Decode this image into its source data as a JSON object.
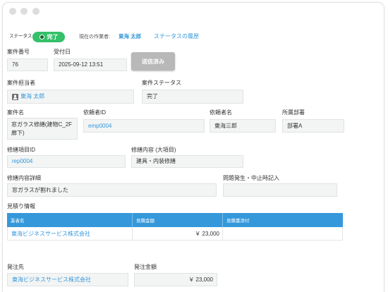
{
  "colors": {
    "link": "#3498db",
    "accent": "#3498db",
    "badge": "#35c06a",
    "field_bg": "#f3f4f4",
    "field_border": "#e0e3e4",
    "button": "#b8b8b8",
    "dot": "#dddddd"
  },
  "icons": {
    "window_controls": [
      "window-close-dot",
      "window-minimize-dot",
      "window-maximize-dot"
    ],
    "status_dot": "dot-icon",
    "owner_avatar": "user-icon"
  },
  "status_bar": {
    "status_label": "ステータス:",
    "status_value": "完了",
    "assignee_label": "現在の作業者:",
    "assignee_name": "東海 太郎",
    "history_link": "ステータスの履歴"
  },
  "fields": {
    "case_number": {
      "label": "案件番号",
      "value": "76"
    },
    "received_at": {
      "label": "受付日",
      "value": "2025-09-12 13:51"
    },
    "sent_button": "送信済み",
    "case_owner": {
      "label": "案件担当者",
      "value": "東海 太郎"
    },
    "case_status": {
      "label": "案件ステータス",
      "value": "完了"
    },
    "case_name": {
      "label": "案件名",
      "value": "窓ガラス修繕(建物C_2F廊下)"
    },
    "requester_id": {
      "label": "依頼者ID",
      "value": "emp0004"
    },
    "requester_name": {
      "label": "依頼者名",
      "value": "東海三郎"
    },
    "department": {
      "label": "所属部署",
      "value": "部署A"
    },
    "repair_item_id": {
      "label": "修繕項目ID",
      "value": "rep0004"
    },
    "repair_category": {
      "label": "修繕内容 (大項目)",
      "value": "建具・内装修繕"
    },
    "repair_detail": {
      "label": "修繕内容詳細",
      "value": "窓ガラスが割れました"
    },
    "issue_note": {
      "label": "問題発生・中止時記入",
      "value": ""
    }
  },
  "estimate": {
    "title": "見積り情報",
    "columns": [
      "業者名",
      "見積金額",
      "見積書添付"
    ],
    "rows": [
      {
        "vendor": "東海ビジネスサービス株式会社",
        "amount": "￥ 23,000",
        "attachment": ""
      }
    ]
  },
  "order": {
    "vendor": {
      "label": "発注先",
      "value": "東海ビジネスサービス株式会社"
    },
    "amount": {
      "label": "発注金額",
      "value": "￥ 23,000"
    }
  }
}
